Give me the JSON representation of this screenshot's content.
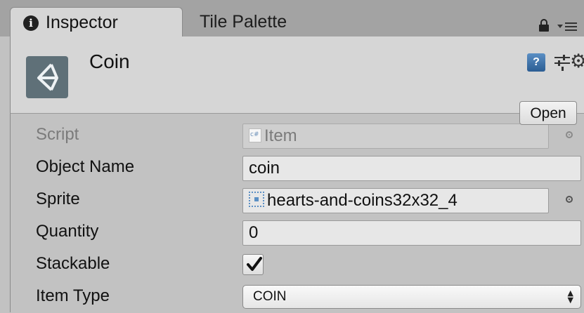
{
  "tabs": [
    {
      "label": "Inspector",
      "active": true,
      "icon": "info-icon"
    },
    {
      "label": "Tile Palette",
      "active": false
    }
  ],
  "header": {
    "object_name": "Coin",
    "icon": "unity-logo-icon",
    "open_label": "Open"
  },
  "fields": {
    "script": {
      "label": "Script",
      "value": "Item",
      "disabled": true
    },
    "object_name": {
      "label": "Object Name",
      "value": "coin"
    },
    "sprite": {
      "label": "Sprite",
      "value": "hearts-and-coins32x32_4"
    },
    "quantity": {
      "label": "Quantity",
      "value": "0"
    },
    "stackable": {
      "label": "Stackable",
      "checked": true
    },
    "item_type": {
      "label": "Item Type",
      "value": "COIN"
    }
  },
  "colors": {
    "panel_bg": "#c2c2c2",
    "tab_bar": "#a3a3a3",
    "accent_blue": "#5b8fc4"
  }
}
